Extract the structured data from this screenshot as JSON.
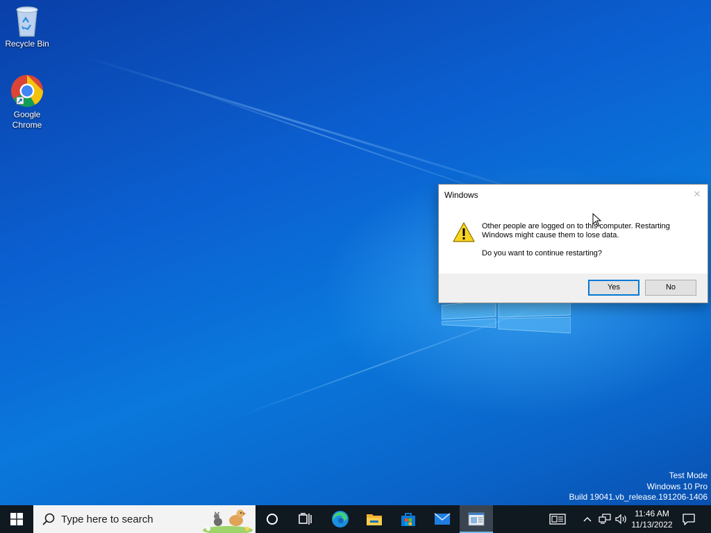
{
  "desktop": {
    "icons": [
      {
        "label": "Recycle Bin",
        "icon": "recycle-bin-icon"
      },
      {
        "label": "Google Chrome",
        "icon": "chrome-icon"
      }
    ],
    "watermark": {
      "line1": "Test Mode",
      "line2": "Windows 10 Pro",
      "line3": "Build 19041.vb_release.191206-1406"
    }
  },
  "dialog": {
    "title": "Windows",
    "close_glyph": "✕",
    "message": "Other people are logged on to this computer. Restarting Windows might cause them to lose data.",
    "question": "Do you want to continue restarting?",
    "yes_label": "Yes",
    "no_label": "No",
    "icon": "warning-icon"
  },
  "taskbar": {
    "search_placeholder": "Type here to search",
    "apps": [
      "cortana-icon",
      "task-view-icon",
      "edge-icon",
      "file-explorer-icon",
      "store-icon",
      "mail-icon",
      "active-app-icon"
    ],
    "clock": {
      "time": "11:46 AM",
      "date": "11/13/2022"
    },
    "tray_icons": [
      "news-icon",
      "chevron-up-icon",
      "network-icon",
      "volume-icon",
      "notification-icon"
    ]
  },
  "colors": {
    "accent": "#0078d7",
    "taskbar_bg": "#101820",
    "dialog_footer": "#f0f0f0"
  }
}
